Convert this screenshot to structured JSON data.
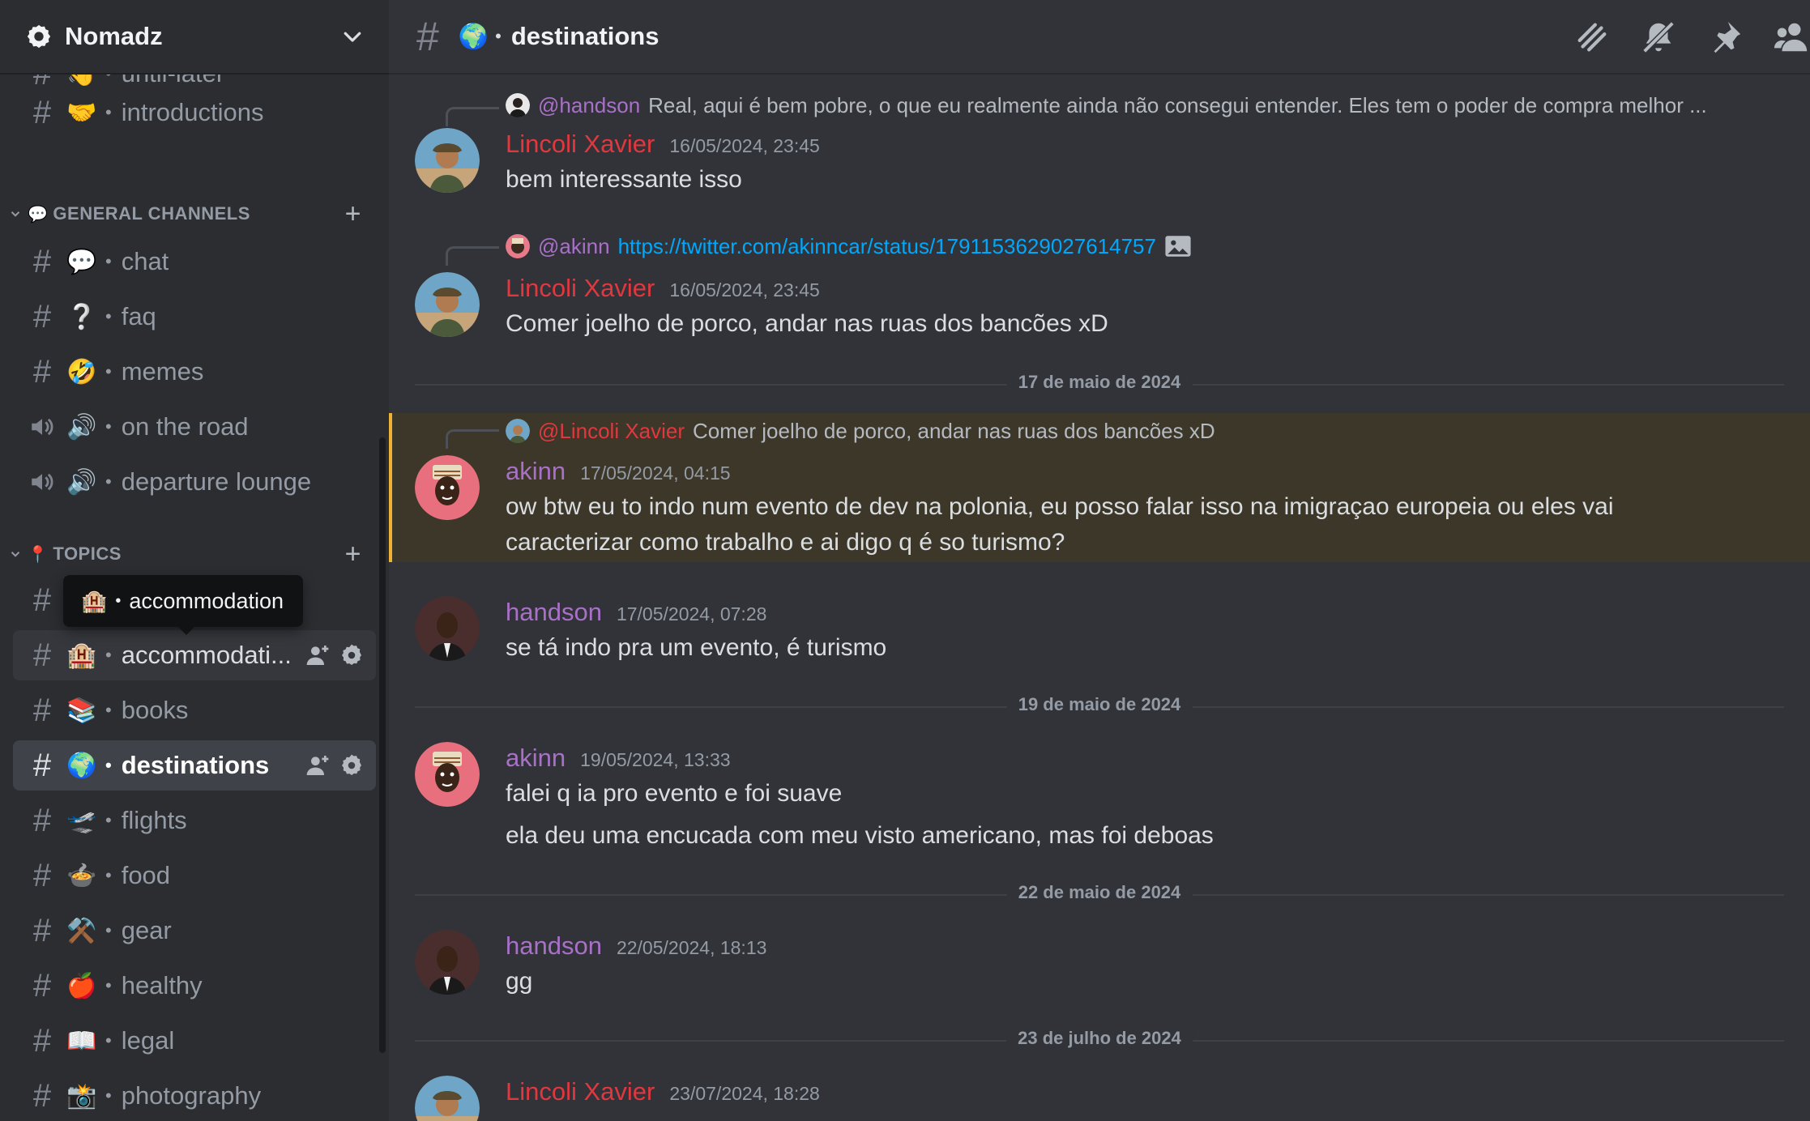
{
  "server": {
    "name": "Nomadz"
  },
  "sidebar": {
    "top_channels": [
      {
        "emoji": "👋",
        "name": "until-later"
      },
      {
        "emoji": "🤝",
        "name": "introductions"
      }
    ],
    "general_category": {
      "label": "GENERAL CHANNELS",
      "emoji": "💬"
    },
    "general_channels": [
      {
        "emoji": "💬",
        "name": "chat",
        "kind": "text"
      },
      {
        "emoji": "❔",
        "name": "faq",
        "kind": "text"
      },
      {
        "emoji": "🤣",
        "name": "memes",
        "kind": "text"
      },
      {
        "emoji": "🔊",
        "name": "on the road",
        "kind": "voice"
      },
      {
        "emoji": "🔊",
        "name": "departure lounge",
        "kind": "voice"
      }
    ],
    "topics_category": {
      "label": "TOPICS",
      "emoji": "📍"
    },
    "tooltip": {
      "emoji": "🏨",
      "name": "accommodation"
    },
    "topic_channels": [
      {
        "emoji": "🏨",
        "name": "accommodati...",
        "state": "hover"
      },
      {
        "emoji": "📚",
        "name": "books",
        "state": ""
      },
      {
        "emoji": "🌍",
        "name": "destinations",
        "state": "active"
      },
      {
        "emoji": "🛫",
        "name": "flights",
        "state": ""
      },
      {
        "emoji": "🍲",
        "name": "food",
        "state": ""
      },
      {
        "emoji": "⚒️",
        "name": "gear",
        "state": ""
      },
      {
        "emoji": "🍎",
        "name": "healthy",
        "state": ""
      },
      {
        "emoji": "📖",
        "name": "legal",
        "state": ""
      },
      {
        "emoji": "📸",
        "name": "photography",
        "state": ""
      }
    ]
  },
  "channel": {
    "emoji": "🌍",
    "name": "destinations"
  },
  "header_icons": [
    "threads-icon",
    "mute-bell-icon",
    "pin-icon",
    "member-list-icon"
  ],
  "messages": [
    {
      "reply_to": {
        "name": "@handson",
        "text": "Real, aqui é bem pobre, o que eu realmente ainda não consegui entender. Eles tem o poder de compra melhor ...",
        "color": "#a970c8"
      },
      "author": "Lincoli Xavier",
      "author_color": "#e0383e",
      "timestamp": "16/05/2024, 23:45",
      "lines": [
        "bem interessante isso"
      ]
    },
    {
      "reply_to": {
        "name": "@akinn",
        "link": "https://twitter.com/akinncar/status/1791153629027614757",
        "color": "#a970c8"
      },
      "author": "Lincoli Xavier",
      "author_color": "#e0383e",
      "timestamp": "16/05/2024, 23:45",
      "lines": [
        "Comer joelho de porco, andar nas ruas dos bancões xD"
      ]
    },
    {
      "reply_to": {
        "name": "@Lincoli Xavier",
        "text": "Comer joelho de porco, andar nas ruas dos bancões xD",
        "color": "#e0383e"
      },
      "author": "akinn",
      "author_color": "#a970c8",
      "timestamp": "17/05/2024, 04:15",
      "lines": [
        "ow btw eu to indo num evento de dev na polonia, eu posso falar isso na imigraçao europeia ou eles vai",
        "caracterizar como trabalho e ai digo q é so turismo?"
      ]
    },
    {
      "author": "handson",
      "author_color": "#a970c8",
      "timestamp": "17/05/2024, 07:28",
      "lines": [
        "se tá indo pra um evento, é turismo"
      ]
    },
    {
      "author": "akinn",
      "author_color": "#a970c8",
      "timestamp": "19/05/2024, 13:33",
      "lines": [
        "falei q ia pro evento e foi suave",
        "ela deu uma encucada com meu visto americano, mas foi deboas"
      ]
    },
    {
      "author": "handson",
      "author_color": "#a970c8",
      "timestamp": "22/05/2024, 18:13",
      "lines": [
        "gg"
      ]
    },
    {
      "author": "Lincoli Xavier",
      "author_color": "#e0383e",
      "timestamp": "23/07/2024, 18:28",
      "lines": []
    }
  ],
  "dividers": [
    "17 de maio de 2024",
    "19 de maio de 2024",
    "22 de maio de 2024",
    "23 de julho de 2024"
  ],
  "colors": {
    "accent_mention": "#f0b232",
    "link": "#00a8fc",
    "red_user": "#e0383e",
    "purple_user": "#a970c8"
  }
}
